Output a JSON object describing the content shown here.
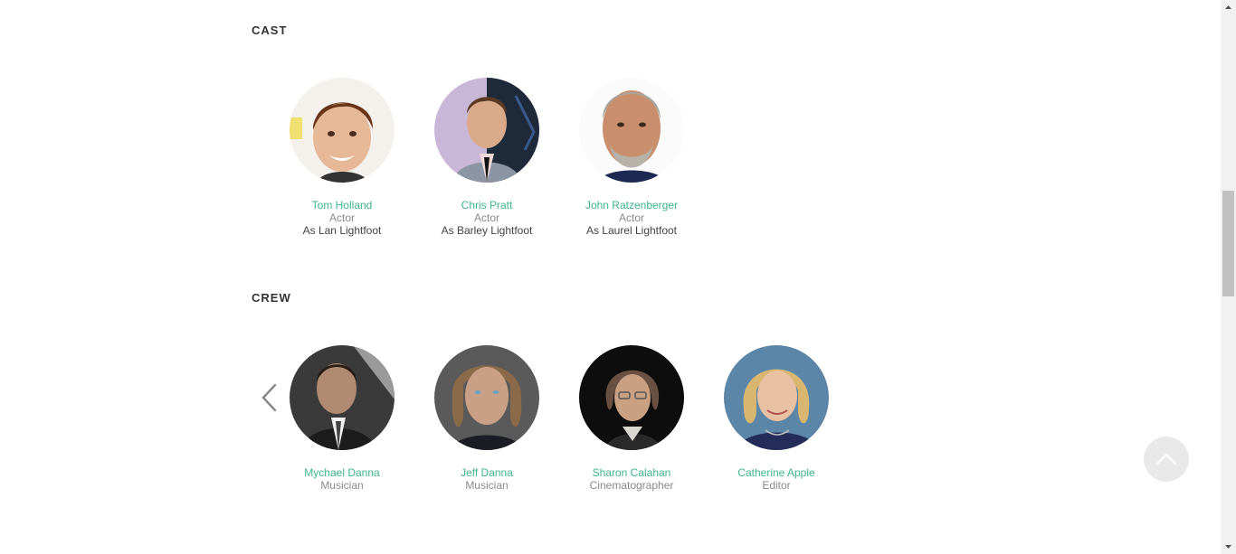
{
  "cast": {
    "title": "CAST",
    "members": [
      {
        "name": "Tom Holland",
        "role": "Actor",
        "character": "As Lan Lightfoot",
        "photo_icon": "person-photo"
      },
      {
        "name": "Chris Pratt",
        "role": "Actor",
        "character": "As Barley Lightfoot",
        "photo_icon": "person-photo"
      },
      {
        "name": "John Ratzenberger",
        "role": "Actor",
        "character": "As Laurel Lightfoot",
        "photo_icon": "person-photo"
      }
    ]
  },
  "crew": {
    "title": "CREW",
    "members": [
      {
        "name": "Mychael Danna",
        "role": "Musician",
        "photo_icon": "person-photo"
      },
      {
        "name": "Jeff Danna",
        "role": "Musician",
        "photo_icon": "person-photo"
      },
      {
        "name": "Sharon Calahan",
        "role": "Cinematographer",
        "photo_icon": "person-photo"
      },
      {
        "name": "Catherine Apple",
        "role": "Editor",
        "photo_icon": "person-photo"
      }
    ]
  },
  "controls": {
    "prev_icon": "chevron-left-icon",
    "scroll_top_icon": "chevron-up-icon"
  },
  "colors": {
    "name_link": "#3fb68b",
    "role_text": "#8a8a8a",
    "title_text": "#333333",
    "scroll_top_bg": "#e9e9e9"
  }
}
